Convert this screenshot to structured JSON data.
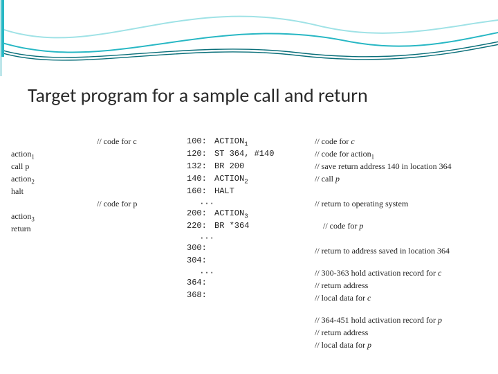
{
  "title": "Target program for a sample call and return",
  "left": {
    "code_for_c_comment": "// code for c",
    "action1_text": "action",
    "action1_sub": "1",
    "call_p": "call p",
    "action2_text": "action",
    "action2_sub": "2",
    "halt": "halt",
    "code_for_p_comment": "// code for p",
    "action3_text": "action",
    "action3_sub": "3",
    "return": "return"
  },
  "mid": {
    "r1": {
      "addr": "100:",
      "instr_text": "ACTION",
      "instr_sub": "1"
    },
    "r2": {
      "addr": "120:",
      "instr_text": "ST 364, #140"
    },
    "r3": {
      "addr": "132:",
      "instr_text": "BR 200"
    },
    "r4": {
      "addr": "140:",
      "instr_text": "ACTION",
      "instr_sub": "2"
    },
    "r5": {
      "addr": "160:",
      "instr_text": "HALT"
    },
    "dots1": "···",
    "r6": {
      "addr": "200:",
      "instr_text": "ACTION",
      "instr_sub": "3"
    },
    "r7": {
      "addr": "220:",
      "instr_text": "BR *364"
    },
    "dots2": "···",
    "r8": {
      "addr": "300:"
    },
    "r9": {
      "addr": "304:"
    },
    "dots3": "···",
    "r10": {
      "addr": "364:"
    },
    "r11": {
      "addr": "368:"
    }
  },
  "right": {
    "c1": {
      "text": "// code for ",
      "ital": "c"
    },
    "c2": {
      "text": "// code for action",
      "sub": "1"
    },
    "c3": "// save return address 140 in location 364",
    "c4": {
      "text": "// call ",
      "ital": "p"
    },
    "c5": "// return to operating system",
    "c6": {
      "text": "// code for ",
      "ital": "p"
    },
    "c7": "// return to address saved in location 364",
    "c8": {
      "text": "// 300-363 hold activation record for ",
      "ital": "c"
    },
    "c9": "// return address",
    "c10": {
      "text": "// local data for ",
      "ital": "c"
    },
    "c11": {
      "text": "// 364-451 hold activation record for ",
      "ital": "p"
    },
    "c12": "// return address",
    "c13": {
      "text": "// local data for ",
      "ital": "p"
    }
  }
}
